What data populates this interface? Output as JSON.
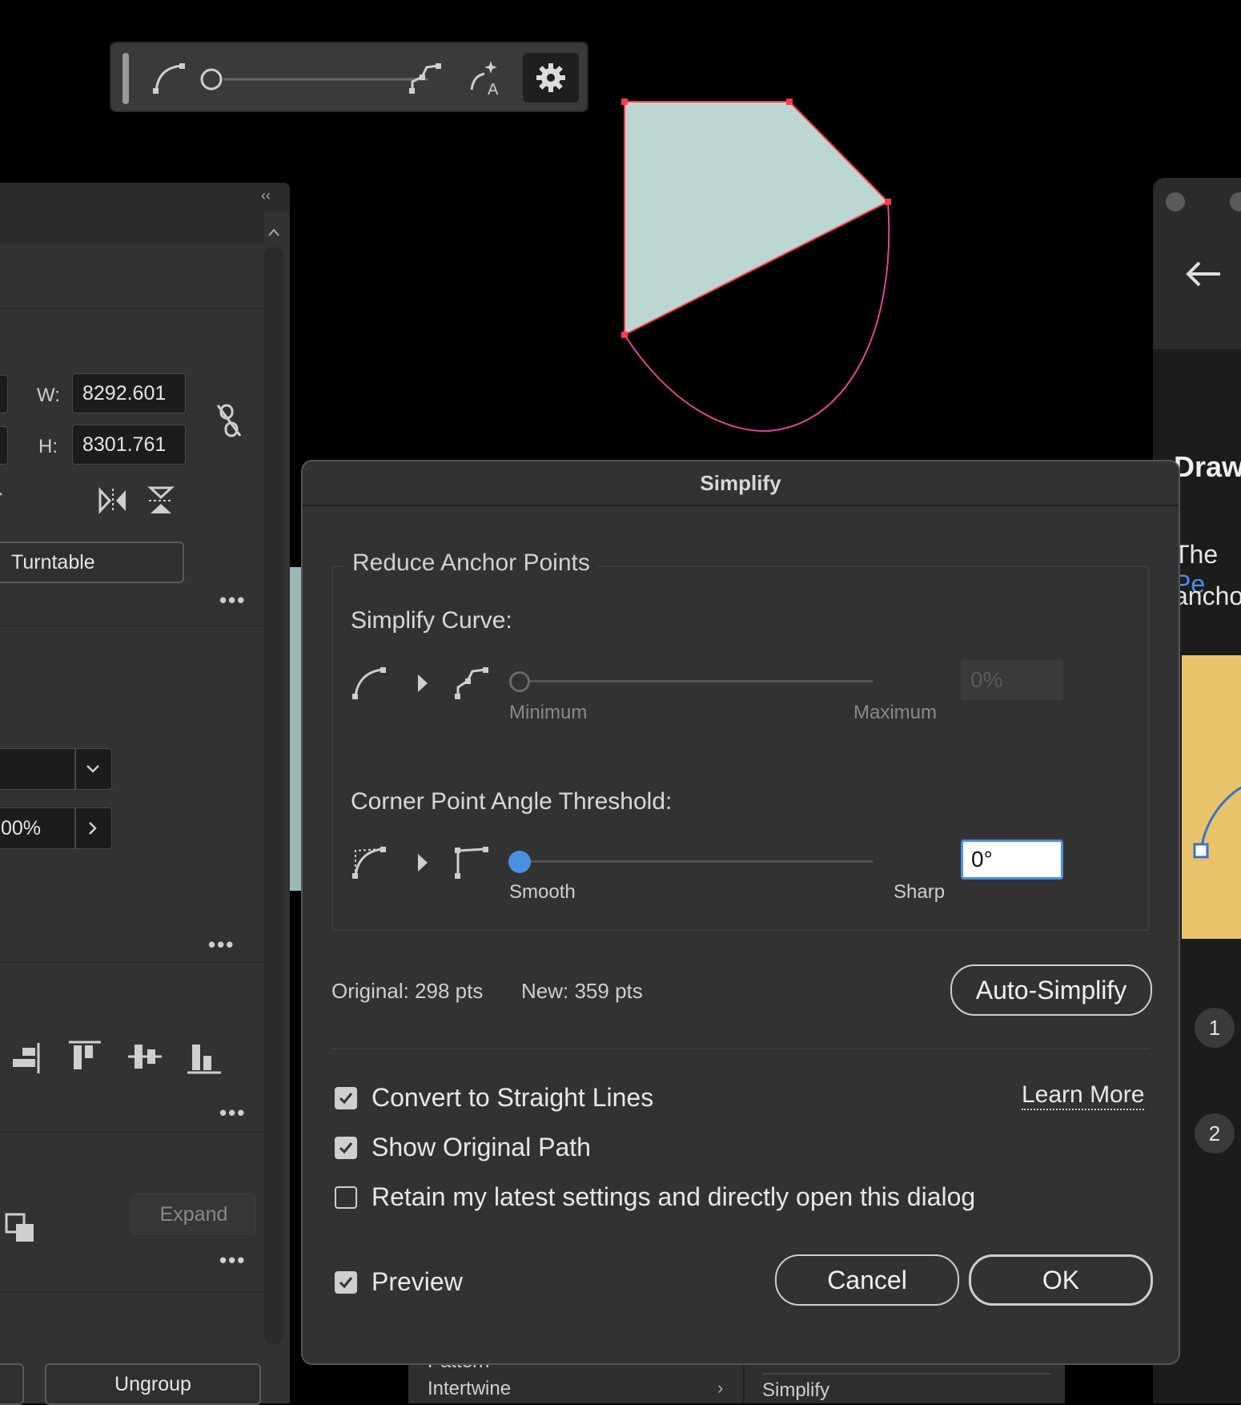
{
  "toolbar": {
    "icons": [
      "curve-icon",
      "slider-min-handle",
      "simplify-points-icon",
      "auto-simplify-icon",
      "gear-icon"
    ]
  },
  "left_panel": {
    "w_label": "W:",
    "w_value": "8292.601",
    "h_label": "H:",
    "h_value": "8301.761",
    "turntable_label": "Turntable",
    "opacity_value": "00%",
    "expand_label": "Expand",
    "ungroup_label": "Ungroup",
    "more_label": "•••"
  },
  "right_panel": {
    "heading_partial": "Draw",
    "line1_partial_a": "The ",
    "line1_partial_b": "Pe",
    "line2_partial": "ancho",
    "step1": "1",
    "step2": "2"
  },
  "behind_menu": {
    "item1": "Pattern",
    "item2": "Intertwine",
    "submenu_item": "Simplify"
  },
  "dialog": {
    "title": "Simplify",
    "group_legend": "Reduce Anchor Points",
    "simplify_curve_label": "Simplify Curve:",
    "simplify_curve_min": "Minimum",
    "simplify_curve_max": "Maximum",
    "simplify_curve_value": "0%",
    "simplify_curve_level": 0,
    "corner_label": "Corner Point Angle Threshold:",
    "corner_min": "Smooth",
    "corner_max": "Sharp",
    "corner_value": "0°",
    "corner_level": 0,
    "original_pts": "Original: 298 pts",
    "new_pts": "New: 359 pts",
    "auto_simplify": "Auto-Simplify",
    "convert_straight": "Convert to Straight Lines",
    "convert_straight_checked": true,
    "show_original": "Show Original Path",
    "show_original_checked": true,
    "retain_settings": "Retain my latest settings and directly open this dialog",
    "retain_settings_checked": false,
    "learn_more": "Learn More",
    "preview": "Preview",
    "preview_checked": true,
    "cancel": "Cancel",
    "ok": "OK"
  },
  "colors": {
    "accent_blue": "#4a90e2",
    "path_pink": "#e2449a",
    "shape_fill": "#bcd6d3",
    "anchor_red": "#ff3b4a",
    "help_card_yellow": "#e8c36a"
  }
}
